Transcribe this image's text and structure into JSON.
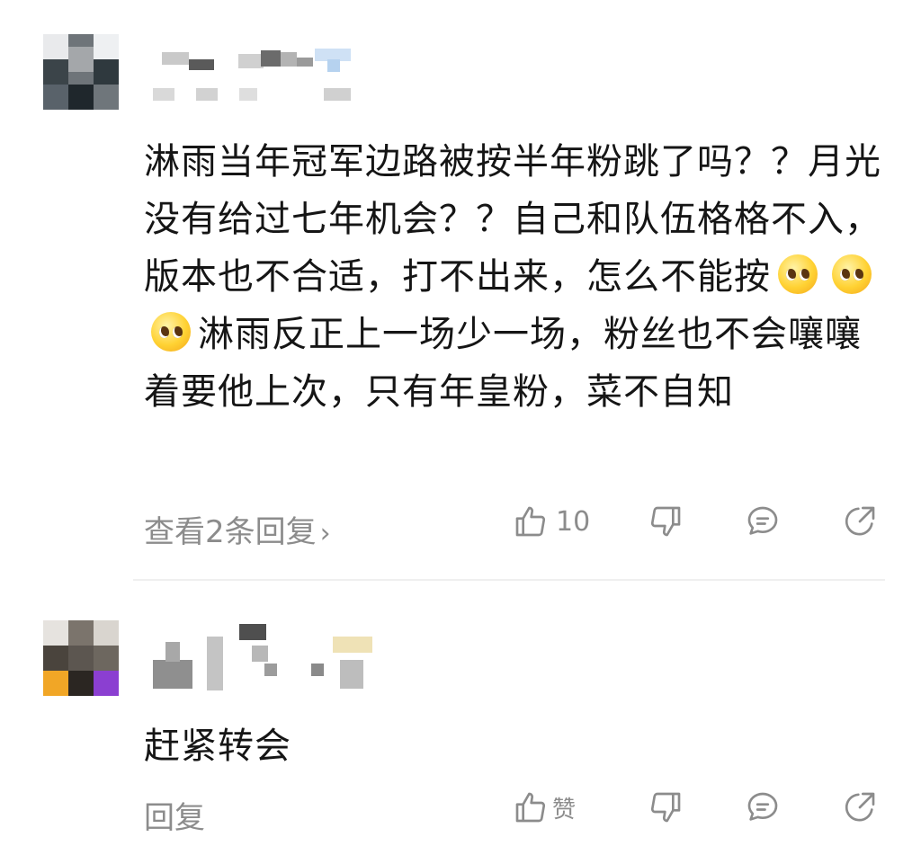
{
  "comments": [
    {
      "text_parts": [
        "淋雨当年冠军边路被按半年粉跳了吗？？月光没有给过七年机会？？自己和队伍格格不入，版本也不合适，打不出来，怎么不能按",
        "淋雨反正上一场少一场，粉丝也不会嚷嚷着要他上次，只有年皇粉，菜不自知"
      ],
      "emoji_count": 3,
      "emoji_icon": "pleading-face-emoji",
      "reply_link": "查看2条回复",
      "reply_chevron": "›",
      "like_count": "10"
    },
    {
      "text": "赶紧转会",
      "reply_link": "回复",
      "like_label": "赞"
    }
  ],
  "icons": {
    "like": "thumbs-up-icon",
    "dislike": "thumbs-down-icon",
    "comment": "comment-bubble-icon",
    "share": "share-icon"
  },
  "colors": {
    "text": "#151515",
    "muted": "#8c8c8c",
    "divider": "#efefef"
  }
}
